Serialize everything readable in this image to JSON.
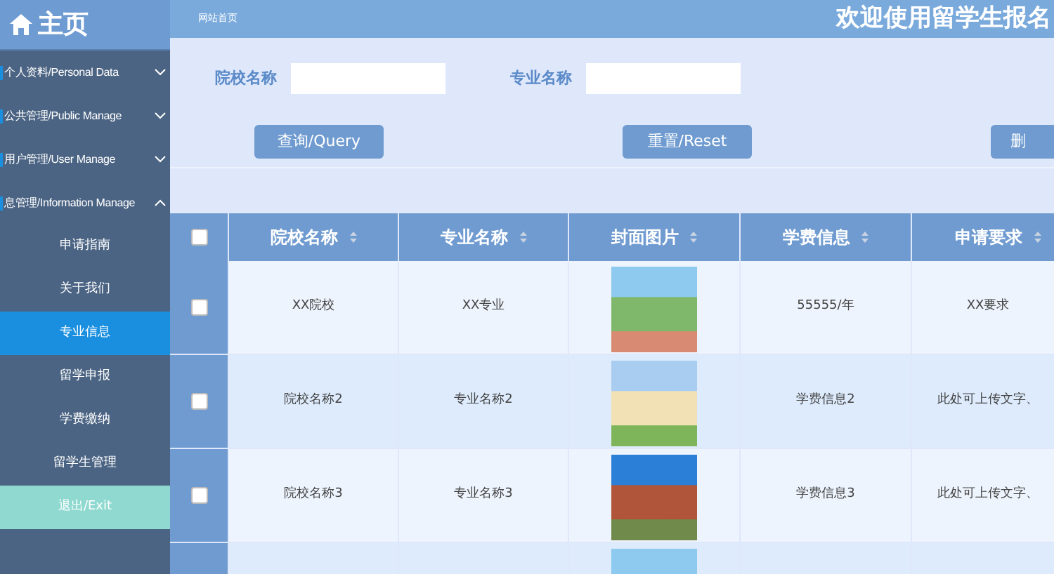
{
  "sidebar": {
    "title": "主页",
    "groups": [
      {
        "label": "个人资料/Personal Data",
        "expanded": false
      },
      {
        "label": "公共管理/Public Manage",
        "expanded": false
      },
      {
        "label": "用户管理/User Manage",
        "expanded": false
      },
      {
        "label": "息管理/Information Manage",
        "expanded": true,
        "children": [
          {
            "label": "申请指南",
            "selected": false
          },
          {
            "label": "关于我们",
            "selected": false
          },
          {
            "label": "专业信息",
            "selected": true
          },
          {
            "label": "留学申报",
            "selected": false
          },
          {
            "label": "学费缴纳",
            "selected": false
          },
          {
            "label": "留学生管理",
            "selected": false
          }
        ]
      }
    ],
    "exit": "退出/Exit"
  },
  "top_bar": {
    "breadcrumb": "网站首页",
    "title": "欢迎使用留学生报名"
  },
  "search": {
    "fields": [
      {
        "label": "院校名称"
      },
      {
        "label": "专业名称"
      }
    ],
    "buttons": [
      "查询/Query",
      "重置/Reset",
      "删"
    ]
  },
  "table": {
    "header_checked": false,
    "columns": [
      "院校名称",
      "专业名称",
      "封面图片",
      "学费信息",
      "申请要求"
    ],
    "rows": [
      {
        "checked": false,
        "school": "XX院校",
        "major": "XX专业",
        "tuition": "55555/年",
        "requirement": "XX要求"
      },
      {
        "checked": false,
        "school": "院校名称2",
        "major": "专业名称2",
        "tuition": "学费信息2",
        "requirement": "此处可上传文字、"
      },
      {
        "checked": false,
        "school": "院校名称3",
        "major": "专业名称3",
        "tuition": "学费信息3",
        "requirement": "此处可上传文字、"
      },
      {}
    ]
  }
}
